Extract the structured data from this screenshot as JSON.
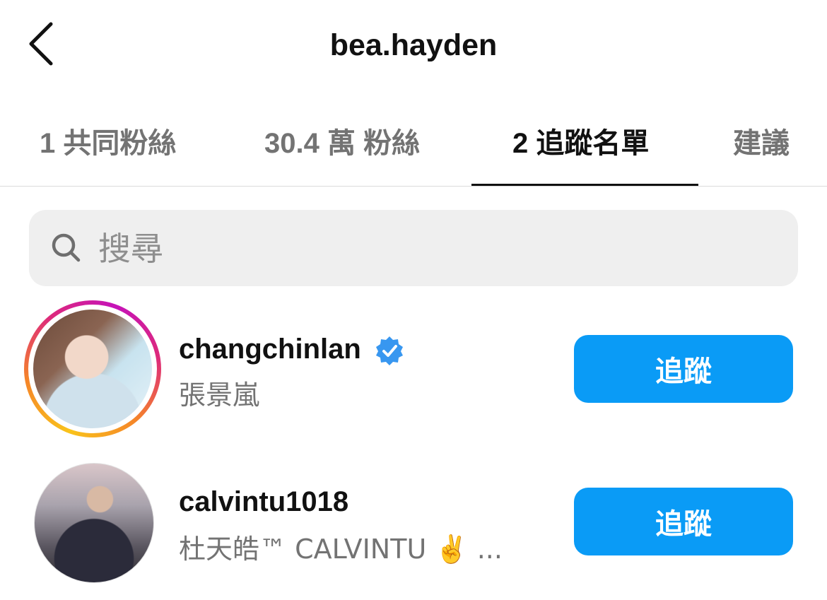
{
  "header": {
    "title": "bea.hayden",
    "back_icon": "chevron-left-icon"
  },
  "tabs": [
    {
      "label": "1 共同粉絲",
      "active": false
    },
    {
      "label": "30.4 萬 粉絲",
      "active": false
    },
    {
      "label": "2 追蹤名單",
      "active": true
    },
    {
      "label": "建議",
      "active": false
    }
  ],
  "search": {
    "placeholder": "搜尋",
    "value": "",
    "icon": "search-icon"
  },
  "following": [
    {
      "username": "changchinlan",
      "verified": true,
      "full_name": "張景嵐",
      "button_label": "追蹤",
      "has_story_ring": true
    },
    {
      "username": "calvintu1018",
      "verified": false,
      "full_name": "杜天皓™ CALVINTU ✌️ ...",
      "button_label": "追蹤",
      "has_story_ring": false
    }
  ],
  "colors": {
    "accent": "#0a9bf6",
    "verified_badge": "#3897f0",
    "secondary_text": "#737373",
    "search_bg": "#efefef"
  }
}
